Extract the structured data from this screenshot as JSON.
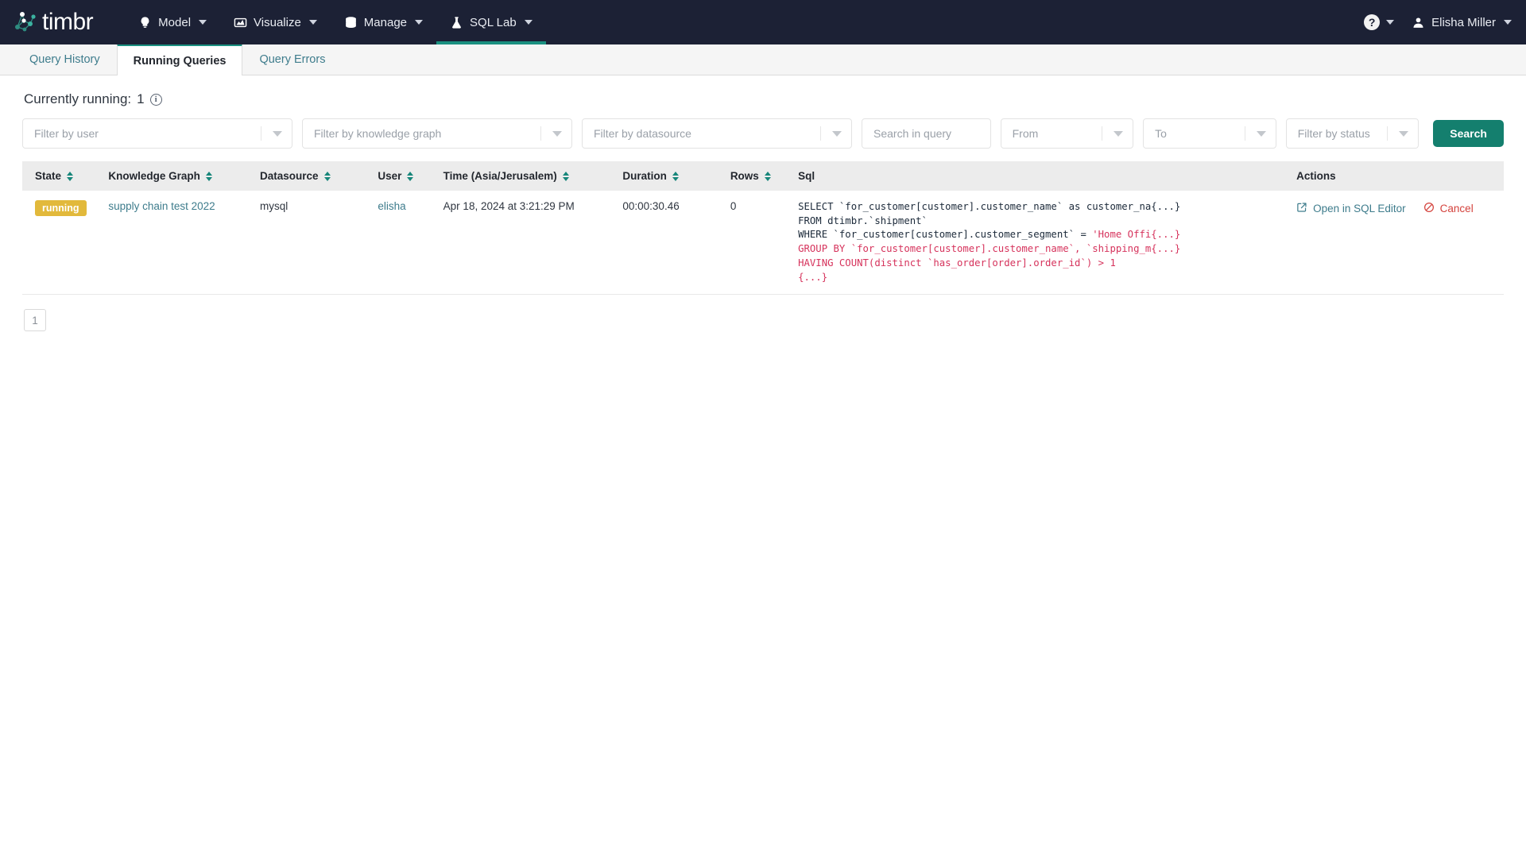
{
  "brand": {
    "name": "timbr",
    "logo_icon": "graph-network-icon"
  },
  "topnav": {
    "items": [
      {
        "label": "Model",
        "icon": "lightbulb-icon",
        "active": false
      },
      {
        "label": "Visualize",
        "icon": "chart-icon",
        "active": false
      },
      {
        "label": "Manage",
        "icon": "database-icon",
        "active": false
      },
      {
        "label": "SQL Lab",
        "icon": "flask-icon",
        "active": true
      }
    ],
    "help_label": "?",
    "user": "Elisha Miller",
    "user_icon": "person-icon",
    "active_color": "#1a9080",
    "background": "#1c2135"
  },
  "tabs": [
    {
      "label": "Query History",
      "active": false
    },
    {
      "label": "Running Queries",
      "active": true
    },
    {
      "label": "Query Errors",
      "active": false
    }
  ],
  "summary": {
    "label": "Currently running:",
    "count": "1",
    "info_icon": "info-icon"
  },
  "filters": {
    "user": {
      "placeholder": "Filter by user",
      "value": ""
    },
    "knowledge": {
      "placeholder": "Filter by knowledge graph",
      "value": ""
    },
    "datasource": {
      "placeholder": "Filter by datasource",
      "value": ""
    },
    "search_query": {
      "placeholder": "Search in query",
      "value": ""
    },
    "from": {
      "placeholder": "From",
      "value": ""
    },
    "to": {
      "placeholder": "To",
      "value": ""
    },
    "status": {
      "placeholder": "Filter by status",
      "value": ""
    },
    "search_button": "Search",
    "search_button_color": "#147f6e"
  },
  "table": {
    "columns": [
      {
        "label": "State",
        "sortable": true
      },
      {
        "label": "Knowledge Graph",
        "sortable": true
      },
      {
        "label": "Datasource",
        "sortable": true
      },
      {
        "label": "User",
        "sortable": true
      },
      {
        "label": "Time (Asia/Jerusalem)",
        "sortable": true
      },
      {
        "label": "Duration",
        "sortable": true
      },
      {
        "label": "Rows",
        "sortable": true
      },
      {
        "label": "Sql",
        "sortable": false
      },
      {
        "label": "Actions",
        "sortable": false
      }
    ],
    "rows": [
      {
        "state": "running",
        "state_color": "#e2b93b",
        "knowledge_graph": "supply chain test 2022",
        "datasource": "mysql",
        "user": "elisha",
        "time": "Apr 18, 2024 at 3:21:29 PM",
        "duration": "00:00:30.46",
        "rows": "0",
        "sql_lines": [
          [
            {
              "t": "SELECT `for_customer[customer].customer_name` as customer_na{...}",
              "kw": false
            }
          ],
          [
            {
              "t": "FROM dtimbr.`shipment`",
              "kw": false
            }
          ],
          [
            {
              "t": "WHERE `for_customer[customer].customer_segment` = ",
              "kw": false
            },
            {
              "t": "'Home Offi{...}",
              "kw": true
            }
          ],
          [
            {
              "t": "GROUP BY `for_customer[customer].customer_name`, `shipping_m{...}",
              "kw": true
            }
          ],
          [
            {
              "t": "HAVING COUNT(distinct `has_order[order].order_id`) > 1",
              "kw": true
            }
          ],
          [
            {
              "t": "{...}",
              "kw": true
            }
          ]
        ],
        "actions": [
          {
            "label": "Open in SQL Editor",
            "icon": "external-link-icon",
            "kind": "open"
          },
          {
            "label": "Cancel",
            "icon": "no-entry-icon",
            "kind": "cancel"
          }
        ]
      }
    ]
  },
  "pagination": {
    "pages": [
      "1"
    ],
    "current": "1"
  }
}
